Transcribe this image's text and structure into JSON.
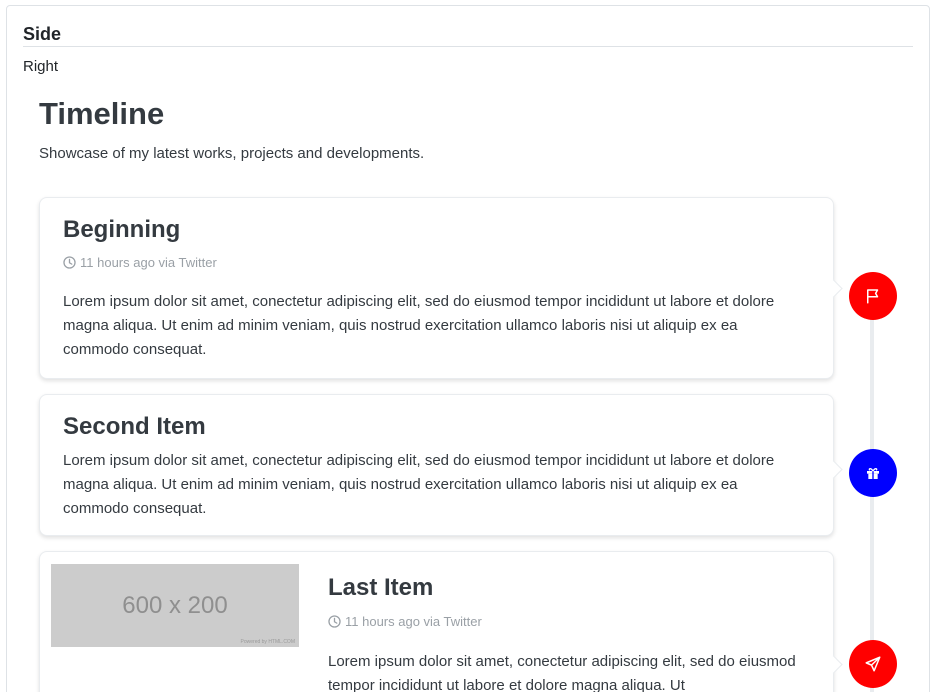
{
  "side": {
    "header": "Side",
    "subtext": "Right"
  },
  "timeline": {
    "title": "Timeline",
    "subtitle": "Showcase of my latest works, projects and developments.",
    "items": [
      {
        "title": "Beginning",
        "meta": "11 hours ago via Twitter",
        "text": "Lorem ipsum dolor sit amet, conectetur adipiscing elit, sed do eiusmod tempor incididunt ut labore et dolore magna aliqua. Ut enim ad minim veniam, quis nostrud exercitation ullamco laboris nisi ut aliquip ex ea commodo consequat.",
        "icon": "flag-icon",
        "color": "#ff0000"
      },
      {
        "title": "Second Item",
        "text": "Lorem ipsum dolor sit amet, conectetur adipiscing elit, sed do eiusmod tempor incididunt ut labore et dolore magna aliqua. Ut enim ad minim veniam, quis nostrud exercitation ullamco laboris nisi ut aliquip ex ea commodo consequat.",
        "icon": "gift-icon",
        "color": "#0000ff"
      },
      {
        "title": "Last Item",
        "meta": "11 hours ago via Twitter",
        "image_label": "600 x 200",
        "image_footer": "Powered by HTML.COM",
        "text": "Lorem ipsum dolor sit amet, conectetur adipiscing elit, sed do eiusmod tempor incididunt ut labore et dolore magna aliqua. Ut",
        "icon": "paper-plane-icon",
        "color": "#ff0000"
      }
    ]
  }
}
